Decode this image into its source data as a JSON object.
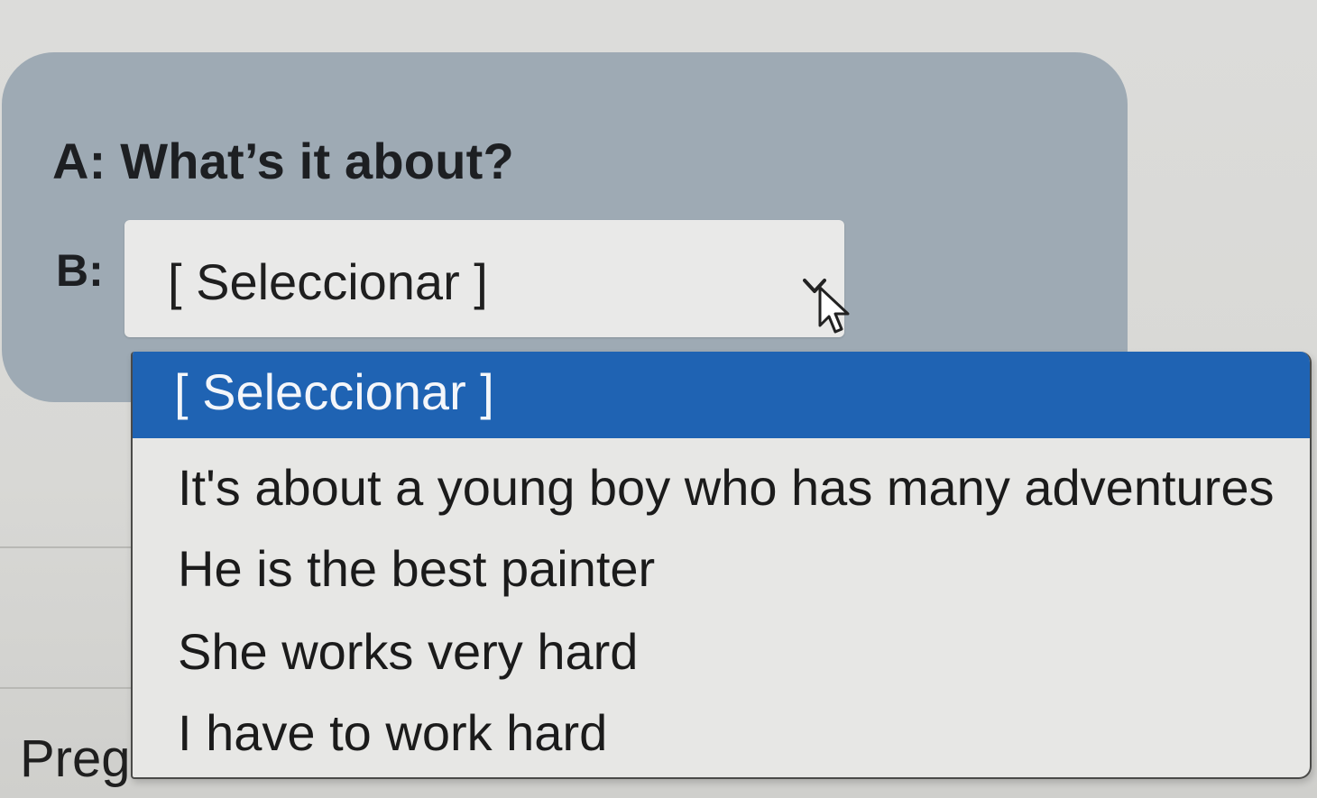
{
  "exercise": {
    "question_a": "A: What’s it about?",
    "answer_b_label": "B:",
    "select": {
      "current_value": "[ Seleccionar ]",
      "options": [
        "[ Seleccionar ]",
        "It's about a young boy who has many adventures",
        "He is the best painter",
        "She works very hard",
        "I have to work hard"
      ],
      "selected_index": 0
    }
  },
  "footer": {
    "label": "Preg"
  },
  "icons": {
    "dropdown": "chevron-down-icon",
    "pointer": "mouse-pointer-icon"
  },
  "colors": {
    "card_background": "#9eaab4",
    "selected_option_background": "#1f63b3",
    "page_background": "#d9d9d6",
    "dropdown_background": "#e7e7e5"
  }
}
